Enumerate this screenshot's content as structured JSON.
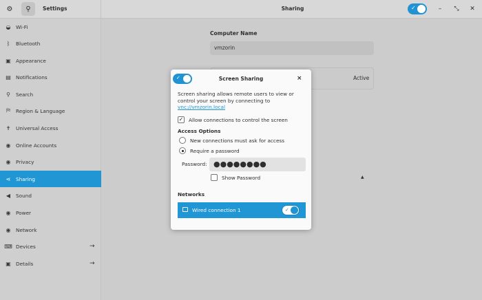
{
  "header": {
    "app_title": "Settings",
    "page_title": "Sharing",
    "sharing_enabled": true,
    "gear_icon": "gear-icon",
    "search_icon": "search-icon",
    "window_controls": [
      "–",
      "⤡",
      "✕"
    ]
  },
  "sidebar": {
    "items": [
      {
        "label": "Wi-Fi",
        "icon": "wifi-icon",
        "glyph": "◒"
      },
      {
        "label": "Bluetooth",
        "icon": "bluetooth-icon",
        "glyph": "ᛒ"
      },
      {
        "label": "Appearance",
        "icon": "appearance-icon",
        "glyph": "▣"
      },
      {
        "label": "Notifications",
        "icon": "notifications-icon",
        "glyph": "▤"
      },
      {
        "label": "Search",
        "icon": "search-icon",
        "glyph": "⚲"
      },
      {
        "label": "Region & Language",
        "icon": "region-icon",
        "glyph": "⛿"
      },
      {
        "label": "Universal Access",
        "icon": "accessibility-icon",
        "glyph": "✝"
      },
      {
        "label": "Online Accounts",
        "icon": "online-accounts-icon",
        "glyph": "◉"
      },
      {
        "label": "Privacy",
        "icon": "privacy-icon",
        "glyph": "◉"
      },
      {
        "label": "Sharing",
        "icon": "sharing-icon",
        "glyph": "⋖"
      },
      {
        "label": "Sound",
        "icon": "sound-icon",
        "glyph": "◀"
      },
      {
        "label": "Power",
        "icon": "power-icon",
        "glyph": "◉"
      },
      {
        "label": "Network",
        "icon": "network-icon",
        "glyph": "◉"
      },
      {
        "label": "Devices",
        "icon": "devices-icon",
        "glyph": "⌨"
      },
      {
        "label": "Details",
        "icon": "details-icon",
        "glyph": "▣"
      }
    ],
    "active": "Sharing",
    "arrow": "→"
  },
  "main": {
    "computer_name_label": "Computer Name",
    "computer_name_value": "vmzorin",
    "service_status": "Active"
  },
  "dialog": {
    "title": "Screen Sharing",
    "enabled": true,
    "close": "×",
    "description": "Screen sharing allows remote users to view or control your screen by connecting to",
    "link": "vnc://vmzorin.local",
    "allow_control_label": "Allow connections to control the screen",
    "allow_control_checked": true,
    "access_options_label": "Access Options",
    "access_options": [
      {
        "label": "New connections must ask for access",
        "selected": false
      },
      {
        "label": "Require a password",
        "selected": true
      }
    ],
    "password_label": "Password:",
    "password_value": "●●●●●●●●",
    "show_password_label": "Show Password",
    "show_password_checked": false,
    "networks_label": "Networks",
    "network_name": "Wired connection 1",
    "network_enabled": true
  },
  "colors": {
    "accent": "#2196d4",
    "sidebar_bg": "#cfcfcf",
    "dialog_bg": "#fafafa"
  }
}
